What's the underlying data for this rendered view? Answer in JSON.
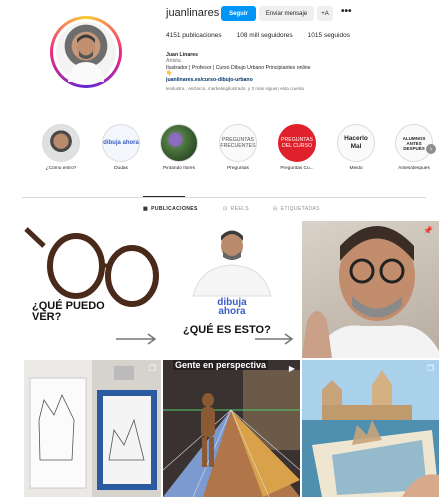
{
  "profile": {
    "username": "juanlinares",
    "follow_label": "Seguir",
    "message_label": "Enviar mensaje",
    "add_label": "+A",
    "more_label": "•••",
    "stats": {
      "posts": "4151 publicaciones",
      "followers": "108 mill seguidores",
      "following": "1015 seguidos"
    },
    "bio": {
      "name": "Juan Linares",
      "category": "Artista",
      "description": "Ilustrador | Profesor | Curso Dibujo Urbano Principiantes online",
      "emoji": "👇",
      "link": "juanlinares.es/curso-dibujo-urbano",
      "followed_by": "leoilustra , esclarco, marketingilustrado, y 3 más siguen esta cuenta"
    }
  },
  "highlights": [
    {
      "label": "¿Cómo entro?",
      "circle_text": ""
    },
    {
      "label": "Dudas",
      "circle_text": "dibuja ahora"
    },
    {
      "label": "Pintando flores",
      "circle_text": ""
    },
    {
      "label": "Preguntas",
      "circle_text": "PREGUNTAS FRECUENTES"
    },
    {
      "label": "Preguntas Cu...",
      "circle_text": "PREGUNTAS DEL CURSO"
    },
    {
      "label": "Miedo",
      "circle_text": "Hacerlo Mal"
    },
    {
      "label": "Antes/después",
      "circle_text": "ALUMNOS ANTES DESPUÉS"
    }
  ],
  "tabs": {
    "posts": "PUBLICACIONES",
    "reels": "REELS",
    "tagged": "ETIQUETADAS"
  },
  "posts": {
    "post1_caption": "¿QUÉ PUEDO VER?",
    "post2_logo": "dibuja ahora",
    "post2_caption": "¿QUÉ ES ESTO?",
    "post5_caption": "Gente en perspectiva"
  },
  "colors": {
    "accent": "#0095f6",
    "highlight_red": "#e0202a"
  }
}
